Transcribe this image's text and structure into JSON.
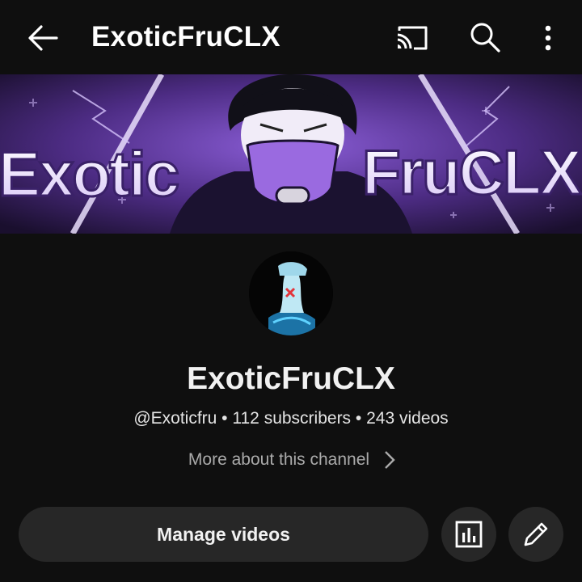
{
  "header": {
    "title": "ExoticFruCLX",
    "icons": [
      "back-arrow-icon",
      "cast-icon",
      "search-icon",
      "more-vert-icon"
    ]
  },
  "banner": {
    "text_left": "Exotic",
    "text_right": "FruCLX",
    "colors": [
      "#2a1746",
      "#8a5dd6",
      "#c9b2f2"
    ]
  },
  "channel": {
    "name": "ExoticFruCLX",
    "handle": "@Exoticfru",
    "separator": "•",
    "subscribers": "112 subscribers",
    "videos": "243 videos",
    "more_about": "More about this channel"
  },
  "actions": {
    "manage_videos": "Manage videos",
    "icons": [
      "analytics-icon",
      "edit-pencil-icon"
    ]
  },
  "colors": {
    "background": "#0f0f0f",
    "button_bg": "#272727",
    "secondary_text": "#aaaaaa",
    "banner_purple": "#8a5dd6"
  }
}
